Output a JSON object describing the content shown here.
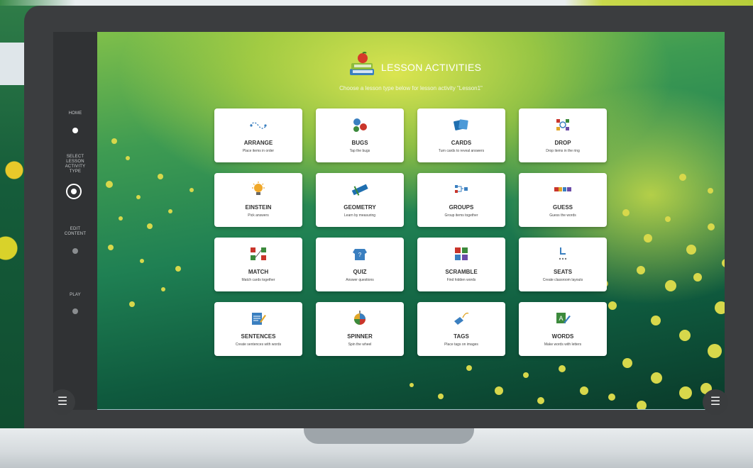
{
  "header": {
    "title": "LESSON ACTIVITIES",
    "subtitle": "Choose a lesson type below for lesson activity \"Lesson1\""
  },
  "sidebar": {
    "steps": [
      {
        "label": "HOME",
        "state": "done"
      },
      {
        "label": "SELECT LESSON ACTIVITY TYPE",
        "state": "current"
      },
      {
        "label": "EDIT CONTENT",
        "state": "pending"
      },
      {
        "label": "PLAY",
        "state": "pending"
      }
    ]
  },
  "activities": [
    {
      "name": "ARRANGE",
      "desc": "Place items in order",
      "icon": "arrange-icon"
    },
    {
      "name": "BUGS",
      "desc": "Tap the bugs",
      "icon": "bugs-icon"
    },
    {
      "name": "CARDS",
      "desc": "Turn cards to reveal answers",
      "icon": "cards-icon"
    },
    {
      "name": "DROP",
      "desc": "Drop items in the ring",
      "icon": "drop-icon"
    },
    {
      "name": "EINSTEIN",
      "desc": "Pick answers",
      "icon": "lightbulb-icon"
    },
    {
      "name": "GEOMETRY",
      "desc": "Learn by measuring",
      "icon": "ruler-icon"
    },
    {
      "name": "GROUPS",
      "desc": "Group items together",
      "icon": "groups-icon"
    },
    {
      "name": "GUESS",
      "desc": "Guess the words",
      "icon": "guess-icon"
    },
    {
      "name": "MATCH",
      "desc": "Match cards together",
      "icon": "match-icon"
    },
    {
      "name": "QUIZ",
      "desc": "Answer questions",
      "icon": "quiz-icon"
    },
    {
      "name": "SCRAMBLE",
      "desc": "Find hidden words",
      "icon": "scramble-icon"
    },
    {
      "name": "SEATS",
      "desc": "Create classroom layouts",
      "icon": "seats-icon"
    },
    {
      "name": "SENTENCES",
      "desc": "Create sentences with words",
      "icon": "sentences-icon"
    },
    {
      "name": "SPINNER",
      "desc": "Spin the wheel",
      "icon": "spinner-icon"
    },
    {
      "name": "TAGS",
      "desc": "Place tags on images",
      "icon": "tags-icon"
    },
    {
      "name": "WORDS",
      "desc": "Make words with letters",
      "icon": "words-icon"
    }
  ],
  "menu": {
    "glyph": "☰"
  },
  "colors": {
    "accent": "#d7d84b",
    "sidebar": "#303234",
    "card": "#ffffff"
  }
}
